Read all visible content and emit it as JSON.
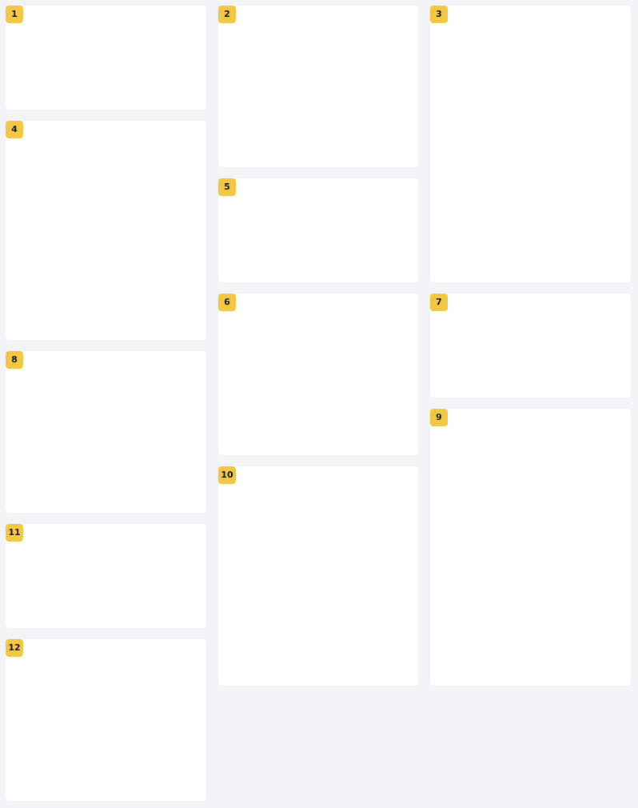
{
  "colors": {
    "page_background": "#f2f4f8",
    "card_background": "#ffffff",
    "badge_background": "#f2c744",
    "badge_text": "#1a1a1a"
  },
  "cards": [
    {
      "label": "1"
    },
    {
      "label": "2"
    },
    {
      "label": "3"
    },
    {
      "label": "4"
    },
    {
      "label": "5"
    },
    {
      "label": "6"
    },
    {
      "label": "7"
    },
    {
      "label": "8"
    },
    {
      "label": "9"
    },
    {
      "label": "10"
    },
    {
      "label": "11"
    },
    {
      "label": "12"
    }
  ]
}
